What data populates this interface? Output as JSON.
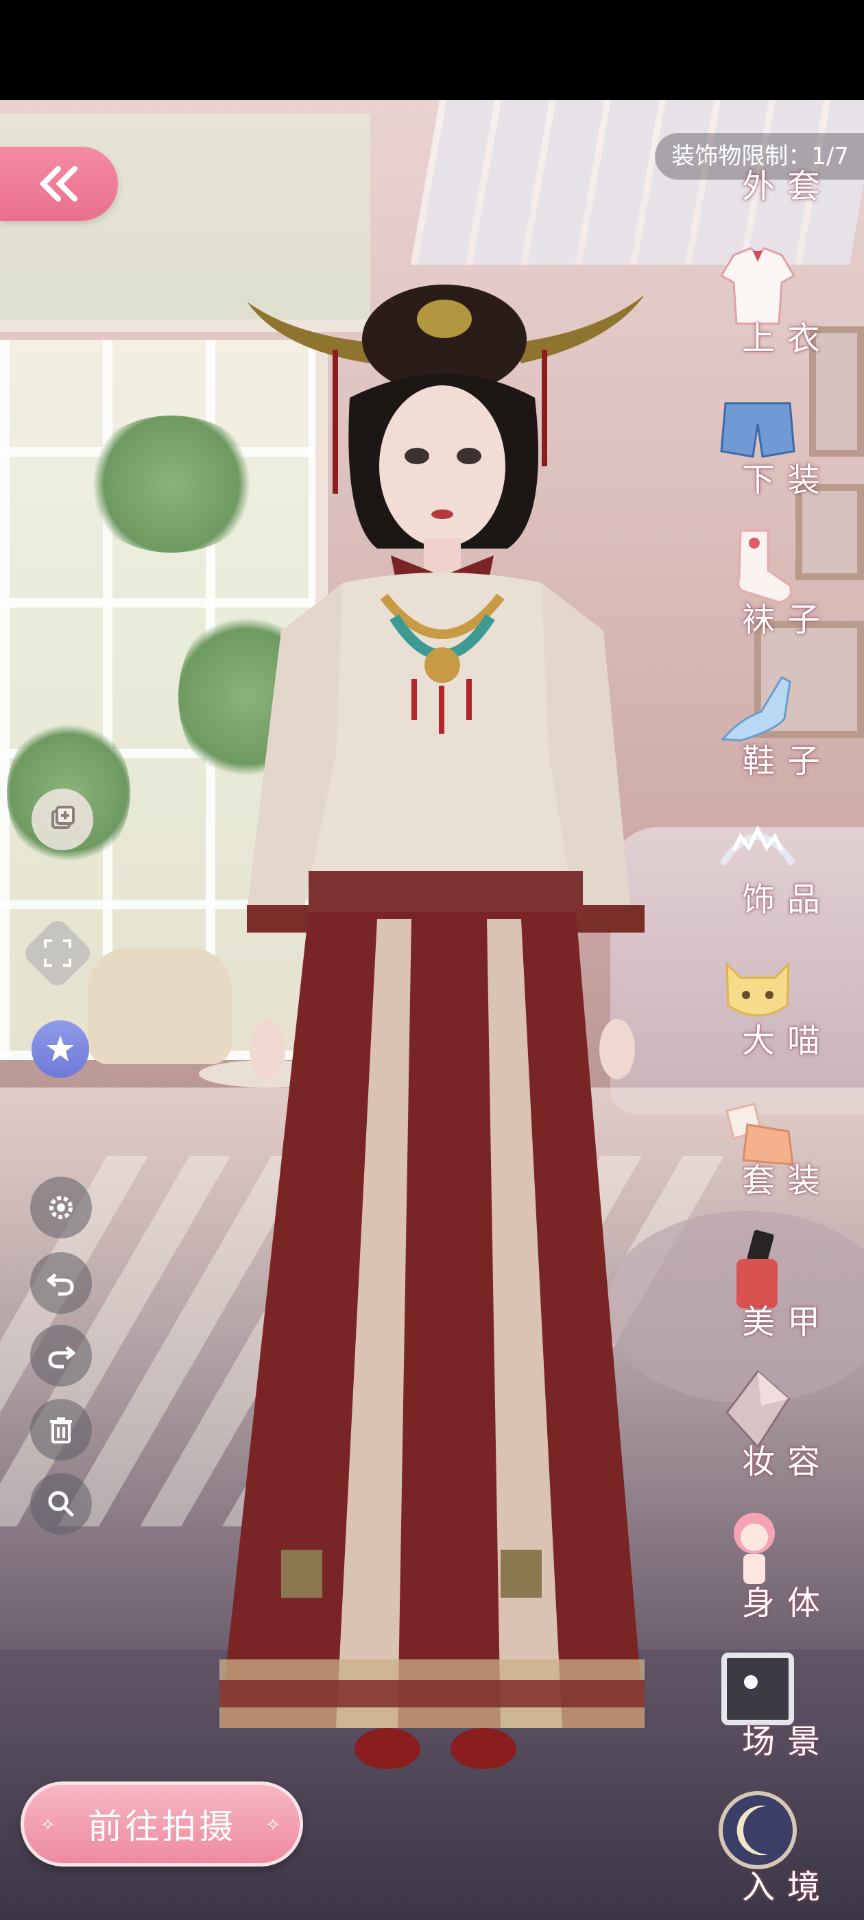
{
  "header": {
    "limit_text": "装饰物限制：1/7"
  },
  "categories": [
    {
      "key": "outerwear",
      "label": "外套",
      "icon": "coat-icon"
    },
    {
      "key": "tops",
      "label": "上衣",
      "icon": "shirt-icon"
    },
    {
      "key": "bottoms",
      "label": "下装",
      "icon": "shorts-icon"
    },
    {
      "key": "socks",
      "label": "袜子",
      "icon": "sock-icon"
    },
    {
      "key": "shoes",
      "label": "鞋子",
      "icon": "shoe-icon"
    },
    {
      "key": "accessories",
      "label": "饰品",
      "icon": "tiara-icon"
    },
    {
      "key": "cat",
      "label": "大喵",
      "icon": "cat-icon"
    },
    {
      "key": "sets",
      "label": "套装",
      "icon": "outfit-set-icon"
    },
    {
      "key": "nails",
      "label": "美甲",
      "icon": "nail-polish-icon"
    },
    {
      "key": "makeup",
      "label": "妆容",
      "icon": "makeup-icon"
    },
    {
      "key": "body",
      "label": "身体",
      "icon": "body-icon"
    },
    {
      "key": "scene",
      "label": "场景",
      "icon": "scene-frame-icon"
    },
    {
      "key": "enter",
      "label": "入境",
      "icon": "moon-icon"
    }
  ],
  "tools": [
    {
      "name": "layer-add-icon"
    },
    {
      "name": "fullscreen-icon"
    },
    {
      "name": "magic-star-icon"
    },
    {
      "name": "settings-gear-icon"
    },
    {
      "name": "undo-icon"
    },
    {
      "name": "redo-icon"
    },
    {
      "name": "trash-icon"
    },
    {
      "name": "zoom-icon"
    }
  ],
  "footer": {
    "go_label": "前往拍摄"
  },
  "colors": {
    "pink_button": "#ee8aa1",
    "skirt_red": "#7a2525",
    "jacket_cream": "#e9dfd4"
  }
}
